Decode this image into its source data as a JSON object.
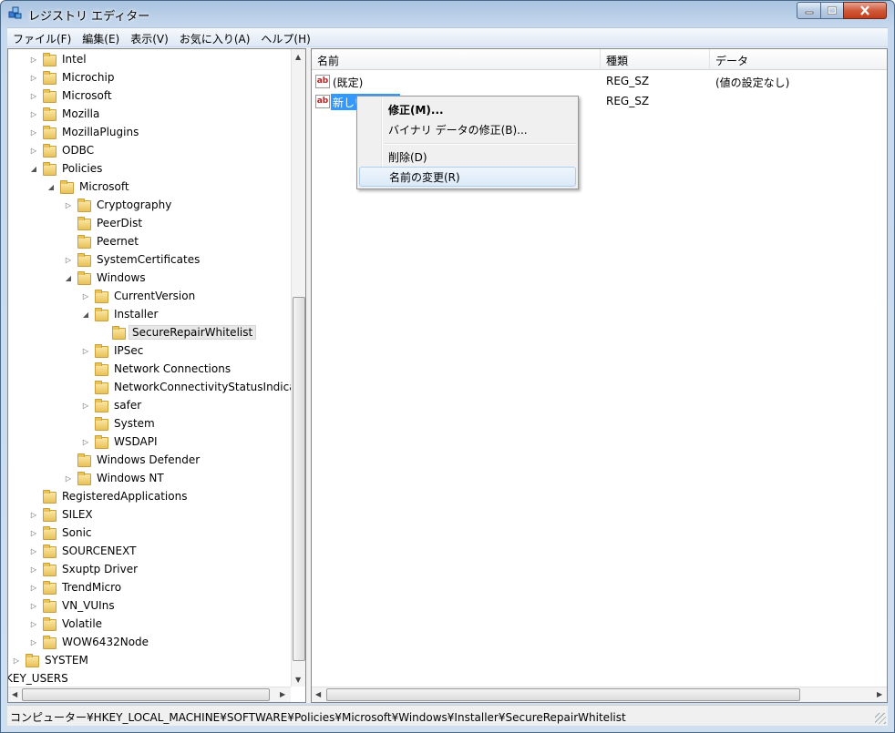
{
  "window": {
    "title": "レジストリ エディター"
  },
  "menu": [
    "ファイル(F)",
    "編集(E)",
    "表示(V)",
    "お気に入り(A)",
    "ヘルプ(H)"
  ],
  "tree": [
    {
      "label": "Intel",
      "level": 1,
      "exp": "closed"
    },
    {
      "label": "Microchip",
      "level": 1,
      "exp": "closed"
    },
    {
      "label": "Microsoft",
      "level": 1,
      "exp": "closed"
    },
    {
      "label": "Mozilla",
      "level": 1,
      "exp": "closed"
    },
    {
      "label": "MozillaPlugins",
      "level": 1,
      "exp": "closed"
    },
    {
      "label": "ODBC",
      "level": 1,
      "exp": "closed"
    },
    {
      "label": "Policies",
      "level": 1,
      "exp": "open"
    },
    {
      "label": "Microsoft",
      "level": 2,
      "exp": "open"
    },
    {
      "label": "Cryptography",
      "level": 3,
      "exp": "closed"
    },
    {
      "label": "PeerDist",
      "level": 3,
      "exp": "none"
    },
    {
      "label": "Peernet",
      "level": 3,
      "exp": "none"
    },
    {
      "label": "SystemCertificates",
      "level": 3,
      "exp": "closed"
    },
    {
      "label": "Windows",
      "level": 3,
      "exp": "open"
    },
    {
      "label": "CurrentVersion",
      "level": 4,
      "exp": "closed"
    },
    {
      "label": "Installer",
      "level": 4,
      "exp": "open"
    },
    {
      "label": "SecureRepairWhitelist",
      "level": 5,
      "exp": "none",
      "selected": true
    },
    {
      "label": "IPSec",
      "level": 4,
      "exp": "closed"
    },
    {
      "label": "Network Connections",
      "level": 4,
      "exp": "none"
    },
    {
      "label": "NetworkConnectivityStatusIndicator",
      "level": 4,
      "exp": "none"
    },
    {
      "label": "safer",
      "level": 4,
      "exp": "closed"
    },
    {
      "label": "System",
      "level": 4,
      "exp": "none"
    },
    {
      "label": "WSDAPI",
      "level": 4,
      "exp": "closed"
    },
    {
      "label": "Windows Defender",
      "level": 3,
      "exp": "none"
    },
    {
      "label": "Windows NT",
      "level": 3,
      "exp": "closed"
    },
    {
      "label": "RegisteredApplications",
      "level": 1,
      "exp": "none"
    },
    {
      "label": "SILEX",
      "level": 1,
      "exp": "closed"
    },
    {
      "label": "Sonic",
      "level": 1,
      "exp": "closed"
    },
    {
      "label": "SOURCENEXT",
      "level": 1,
      "exp": "closed"
    },
    {
      "label": "Sxuptp Driver",
      "level": 1,
      "exp": "closed"
    },
    {
      "label": "TrendMicro",
      "level": 1,
      "exp": "closed"
    },
    {
      "label": "VN_VUIns",
      "level": 1,
      "exp": "closed"
    },
    {
      "label": "Volatile",
      "level": 1,
      "exp": "closed"
    },
    {
      "label": "WOW6432Node",
      "level": 1,
      "exp": "closed"
    },
    {
      "label": "SYSTEM",
      "level": 0,
      "exp": "closed"
    },
    {
      "label": "HKEY_USERS",
      "level": -1,
      "exp": "none",
      "nofolder": true
    }
  ],
  "list": {
    "columns": [
      "名前",
      "種類",
      "データ"
    ],
    "rows": [
      {
        "name": "(既定)",
        "type": "REG_SZ",
        "data": "(値の設定なし)"
      },
      {
        "name": "新しい",
        "type": "REG_SZ",
        "data": "",
        "editing": true
      }
    ]
  },
  "context_menu": {
    "modify": "修正(M)...",
    "modify_binary": "バイナリ データの修正(B)...",
    "delete": "削除(D)",
    "rename": "名前の変更(R)"
  },
  "status": "コンピューター¥HKEY_LOCAL_MACHINE¥SOFTWARE¥Policies¥Microsoft¥Windows¥Installer¥SecureRepairWhitelist"
}
